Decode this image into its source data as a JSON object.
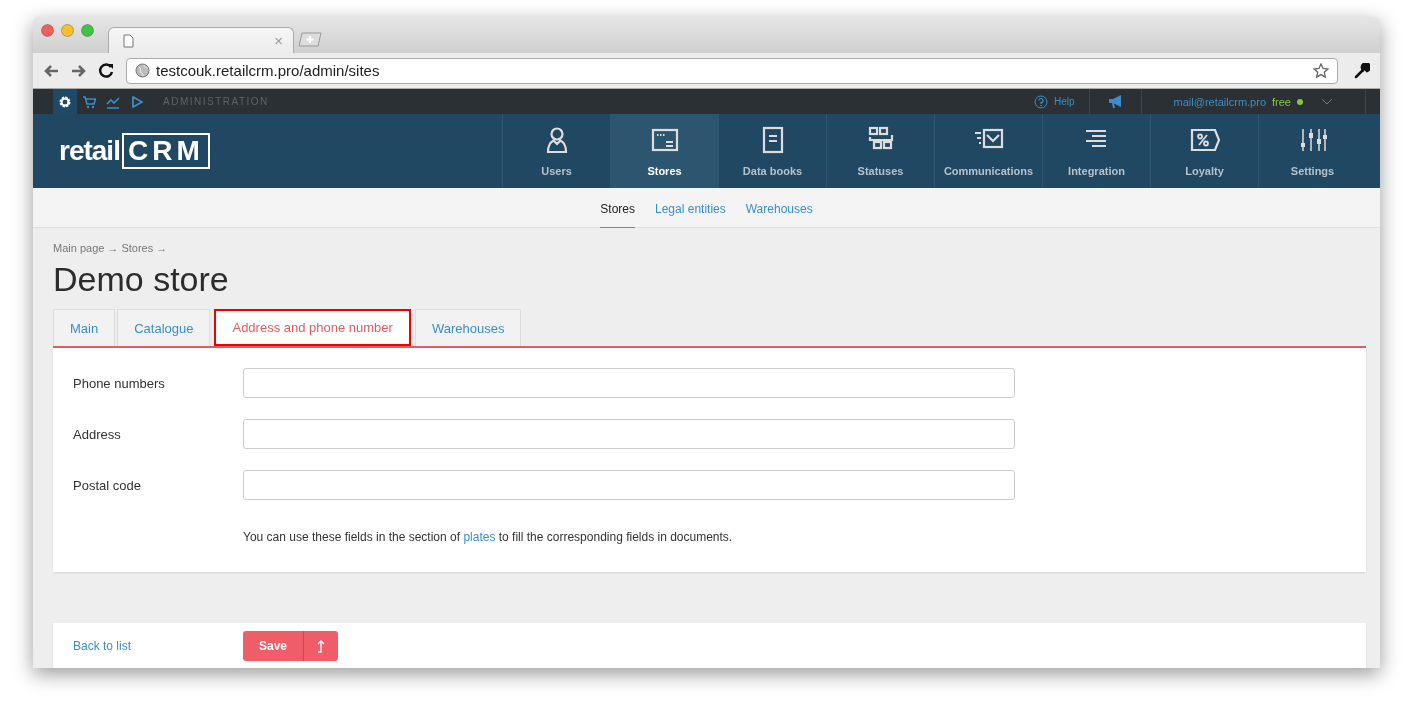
{
  "browser": {
    "tab_close": "×",
    "url": "testcouk.retailcrm.pro/admin/sites"
  },
  "admin_bar": {
    "apps": [
      {
        "selected": true
      },
      {
        "selected": false
      },
      {
        "selected": false
      },
      {
        "selected": false
      }
    ],
    "section": "ADMINISTRATION",
    "help": "Help",
    "email": "mail@retailcrm.pro",
    "plan": "free"
  },
  "logo": {
    "text": "retail",
    "mark": "CRM"
  },
  "nav": [
    {
      "label": "Users",
      "selected": false
    },
    {
      "label": "Stores",
      "selected": true
    },
    {
      "label": "Data books",
      "selected": false
    },
    {
      "label": "Statuses",
      "selected": false
    },
    {
      "label": "Communications",
      "selected": false
    },
    {
      "label": "Integration",
      "selected": false
    },
    {
      "label": "Loyalty",
      "selected": false
    },
    {
      "label": "Settings",
      "selected": false
    }
  ],
  "subnav": [
    {
      "label": "Stores",
      "selected": true
    },
    {
      "label": "Legal entities",
      "selected": false
    },
    {
      "label": "Warehouses",
      "selected": false
    }
  ],
  "breadcrumb": [
    {
      "label": "Main page",
      "separator": "→"
    },
    {
      "label": "Stores",
      "separator": "→"
    }
  ],
  "title": "Demo store",
  "tabs": [
    {
      "label": "Main",
      "selected": false
    },
    {
      "label": "Catalogue",
      "selected": false
    },
    {
      "label": "Address and phone number",
      "selected": true
    },
    {
      "label": "Warehouses",
      "selected": false
    }
  ],
  "fields": [
    {
      "label": "Phone numbers"
    },
    {
      "label": "Address"
    },
    {
      "label": "Postal code"
    }
  ],
  "note": {
    "before": "You can use these fields in the section of ",
    "link": "plates",
    "after": " to fill the corresponding fields in documents."
  },
  "footer": {
    "back": "Back to list",
    "save": "Save"
  }
}
